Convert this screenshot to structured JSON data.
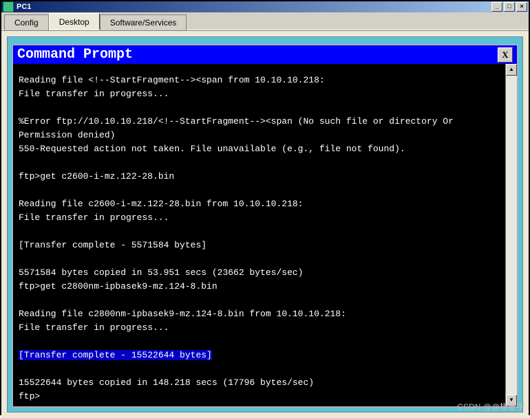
{
  "window": {
    "title": "PC1",
    "min": "_",
    "max": "□",
    "close": "×"
  },
  "tabs": {
    "config": "Config",
    "desktop": "Desktop",
    "software": "Software/Services"
  },
  "cmd": {
    "title": "Command Prompt",
    "close": "X"
  },
  "scrollbar": {
    "up": "▲",
    "down": "▼"
  },
  "terminal": {
    "line01": "Reading file <!--StartFragment--><span from 10.10.10.218:",
    "line02": "File transfer in progress...",
    "line03": "",
    "line04": "%Error ftp://10.10.10.218/<!--StartFragment--><span (No such file or directory Or Permission denied)",
    "line05": "550-Requested action not taken. File unavailable (e.g., file not found).",
    "line06": "",
    "line07": "ftp>get c2600-i-mz.122-28.bin",
    "line08": "",
    "line09": "Reading file c2600-i-mz.122-28.bin from 10.10.10.218:",
    "line10": "File transfer in progress...",
    "line11": "",
    "line12": "[Transfer complete - 5571584 bytes]",
    "line13": "",
    "line14": "5571584 bytes copied in 53.951 secs (23662 bytes/sec)",
    "line15": "ftp>get c2800nm-ipbasek9-mz.124-8.bin",
    "line16": "",
    "line17": "Reading file c2800nm-ipbasek9-mz.124-8.bin from 10.10.10.218:",
    "line18": "File transfer in progress...",
    "line19": "",
    "line20_hl": "[Transfer complete - 15522644 bytes]",
    "line21": "",
    "line22": "15522644 bytes copied in 148.218 secs (17796 bytes/sec)",
    "line23": "ftp>"
  },
  "watermark": "CSDN @@杨星宇"
}
